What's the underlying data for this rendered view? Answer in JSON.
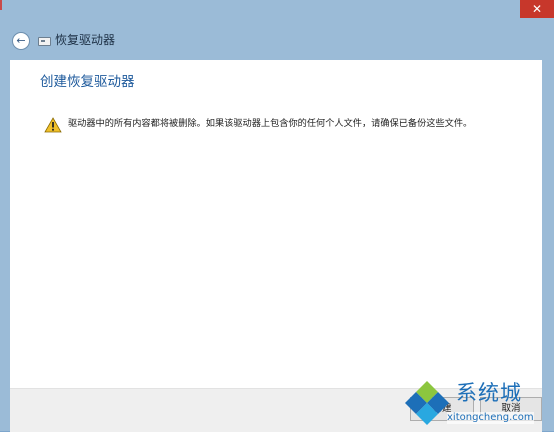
{
  "window": {
    "title": "恢复驱动器",
    "close_glyph": "✕",
    "back_glyph": "←"
  },
  "content": {
    "heading": "创建恢复驱动器",
    "warning_text": "驱动器中的所有内容都将被删除。如果该驱动器上包含你的任何个人文件，请确保已备份这些文件。"
  },
  "footer": {
    "create_label": "创建",
    "cancel_label": "取消"
  },
  "watermark": {
    "cn": "系统城",
    "url": "xitongcheng.com"
  },
  "colors": {
    "accent": "#1e5a9c",
    "titlebar": "#9bbbd7",
    "close": "#c7372b",
    "warning": "#f0c02a"
  },
  "icons": [
    "back-arrow-icon",
    "drive-icon",
    "warning-icon",
    "close-icon",
    "windows-logo-icon"
  ]
}
